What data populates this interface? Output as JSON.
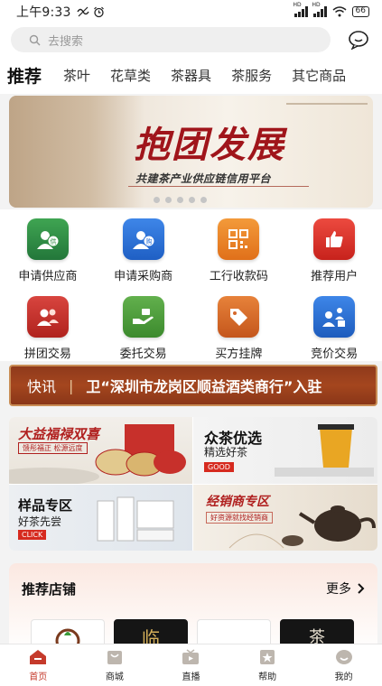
{
  "status": {
    "time": "上午9:33",
    "battery": "66"
  },
  "search": {
    "placeholder": "去搜索"
  },
  "tabs": [
    "推荐",
    "茶叶",
    "花草类",
    "茶器具",
    "茶服务",
    "其它商品"
  ],
  "banner": {
    "title": "抱团发展",
    "subtitle": "共建茶产业供应链信用平台",
    "dot_count": 5
  },
  "grid": [
    {
      "label": "申请供应商",
      "icon": "supplier-icon",
      "color": "#2e8b3f"
    },
    {
      "label": "申请采购商",
      "icon": "purchaser-icon",
      "color": "#2a6fd6"
    },
    {
      "label": "工行收款码",
      "icon": "qr-code-icon",
      "color": "#e8781f"
    },
    {
      "label": "推荐用户",
      "icon": "thumbs-up-icon",
      "color": "#d9312b"
    },
    {
      "label": "拼团交易",
      "icon": "group-icon",
      "color": "#c7302b"
    },
    {
      "label": "委托交易",
      "icon": "delegate-icon",
      "color": "#4f9b3a"
    },
    {
      "label": "买方挂牌",
      "icon": "tag-icon",
      "color": "#d5682a"
    },
    {
      "label": "竞价交易",
      "icon": "auction-icon",
      "color": "#2c73d0"
    }
  ],
  "notice": {
    "label": "快讯",
    "text": "卫“深圳市龙岗区顺益酒类商行”入驻"
  },
  "promos": [
    {
      "title": "大益福禄双喜",
      "sub": "馈彤福正 松源远度"
    },
    {
      "title": "众茶优选",
      "sub": "精选好茶",
      "badge": "GOOD"
    },
    {
      "title": "样品专区",
      "sub": "好茶先尝",
      "badge": "CLICK"
    },
    {
      "title": "经销商专区",
      "sub": "好资源就找经销商"
    }
  ],
  "shops": {
    "title": "推荐店铺",
    "more": "更多",
    "cards": [
      "",
      "临",
      "",
      "茶"
    ]
  },
  "bottom_nav": [
    {
      "label": "首页",
      "icon": "home-icon",
      "active": true
    },
    {
      "label": "商城",
      "icon": "store-icon",
      "active": false
    },
    {
      "label": "直播",
      "icon": "live-icon",
      "active": false
    },
    {
      "label": "帮助",
      "icon": "help-icon",
      "active": false
    },
    {
      "label": "我的",
      "icon": "profile-icon",
      "active": false
    }
  ]
}
